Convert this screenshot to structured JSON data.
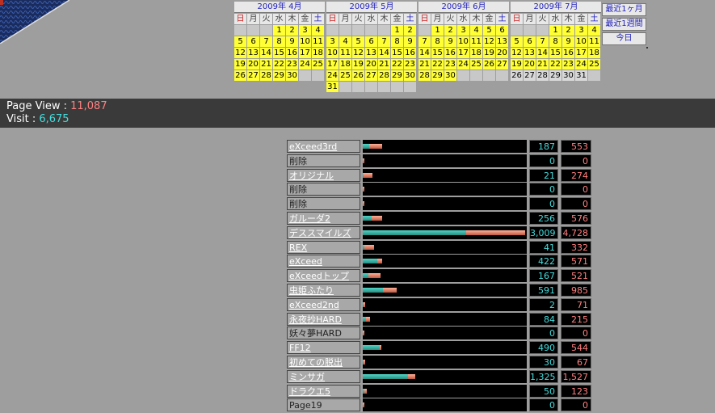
{
  "colors": {
    "background": "#9e9e9e",
    "highlight_day": "#ffff33",
    "page_view": "#ff8080",
    "visit": "#44dddd"
  },
  "weekdays": [
    "日",
    "月",
    "火",
    "水",
    "木",
    "金",
    "土"
  ],
  "calendars": [
    {
      "title": "2009年 4月",
      "days": [
        [
          "",
          "",
          "",
          "1",
          "2",
          "3",
          "4"
        ],
        [
          "5",
          "6",
          "7",
          "8",
          "9",
          "10",
          "11"
        ],
        [
          "12",
          "13",
          "14",
          "15",
          "16",
          "17",
          "18"
        ],
        [
          "19",
          "20",
          "21",
          "22",
          "23",
          "24",
          "25"
        ],
        [
          "26",
          "27",
          "28",
          "29",
          "30",
          "",
          ""
        ]
      ]
    },
    {
      "title": "2009年 5月",
      "days": [
        [
          "",
          "",
          "",
          "",
          "",
          "1",
          "2"
        ],
        [
          "3",
          "4",
          "5",
          "6",
          "7",
          "8",
          "9"
        ],
        [
          "10",
          "11",
          "12",
          "13",
          "14",
          "15",
          "16"
        ],
        [
          "17",
          "18",
          "19",
          "20",
          "21",
          "22",
          "23"
        ],
        [
          "24",
          "25",
          "26",
          "27",
          "28",
          "29",
          "30"
        ],
        [
          "31",
          "",
          "",
          "",
          "",
          "",
          ""
        ]
      ]
    },
    {
      "title": "2009年 6月",
      "days": [
        [
          "",
          "1",
          "2",
          "3",
          "4",
          "5",
          "6"
        ],
        [
          "7",
          "8",
          "9",
          "10",
          "11",
          "12",
          "13"
        ],
        [
          "14",
          "15",
          "16",
          "17",
          "18",
          "19",
          "20"
        ],
        [
          "21",
          "22",
          "23",
          "24",
          "25",
          "26",
          "27"
        ],
        [
          "28",
          "29",
          "30",
          "",
          "",
          "",
          ""
        ]
      ]
    },
    {
      "title": "2009年 7月",
      "days": [
        [
          "",
          "",
          "",
          "1",
          "2",
          "3",
          "4"
        ],
        [
          "5",
          "6",
          "7",
          "8",
          "9",
          "10",
          "11"
        ],
        [
          "12",
          "13",
          "14",
          "15",
          "16",
          "17",
          "18"
        ],
        [
          "19",
          "20",
          "21",
          "22",
          "23",
          "24",
          "25"
        ],
        [
          "26",
          "27",
          "28",
          "29",
          "30",
          "31",
          ""
        ]
      ]
    }
  ],
  "range_links": [
    "最近1ヶ月",
    "最近1週間",
    "今日"
  ],
  "stats": {
    "page_view_label": "Page View : ",
    "page_view": "11,087",
    "visit_label": "Visit : ",
    "visit": "6,675"
  },
  "ranking_max": 4728,
  "ranking": [
    {
      "name": "eXceed3rd",
      "link": true,
      "visit": "187",
      "pv": "553",
      "v": 187,
      "p": 553
    },
    {
      "name": "削除",
      "link": false,
      "visit": "0",
      "pv": "0",
      "v": 0,
      "p": 0
    },
    {
      "name": "オリジナル",
      "link": true,
      "visit": "21",
      "pv": "274",
      "v": 21,
      "p": 274
    },
    {
      "name": "削除",
      "link": false,
      "visit": "0",
      "pv": "0",
      "v": 0,
      "p": 0
    },
    {
      "name": "削除",
      "link": false,
      "visit": "0",
      "pv": "0",
      "v": 0,
      "p": 0
    },
    {
      "name": "ガルーダ2",
      "link": true,
      "visit": "256",
      "pv": "576",
      "v": 256,
      "p": 576
    },
    {
      "name": "デススマイルズ",
      "link": true,
      "visit": "3,009",
      "pv": "4,728",
      "v": 3009,
      "p": 4728
    },
    {
      "name": "REX",
      "link": true,
      "visit": "41",
      "pv": "332",
      "v": 41,
      "p": 332
    },
    {
      "name": "eXceed",
      "link": true,
      "visit": "422",
      "pv": "571",
      "v": 422,
      "p": 571
    },
    {
      "name": "eXceedトップ",
      "link": true,
      "visit": "167",
      "pv": "521",
      "v": 167,
      "p": 521
    },
    {
      "name": "虫姫ふたり",
      "link": true,
      "visit": "591",
      "pv": "985",
      "v": 591,
      "p": 985
    },
    {
      "name": "eXceed2nd",
      "link": true,
      "visit": "2",
      "pv": "71",
      "v": 2,
      "p": 71
    },
    {
      "name": "永夜抄HARD",
      "link": true,
      "visit": "84",
      "pv": "215",
      "v": 84,
      "p": 215
    },
    {
      "name": "妖々夢HARD",
      "link": false,
      "visit": "0",
      "pv": "0",
      "v": 0,
      "p": 0
    },
    {
      "name": "FF12",
      "link": true,
      "visit": "490",
      "pv": "544",
      "v": 490,
      "p": 544
    },
    {
      "name": "初めての脱出",
      "link": true,
      "visit": "30",
      "pv": "67",
      "v": 30,
      "p": 67
    },
    {
      "name": "ミンサガ",
      "link": true,
      "visit": "1,325",
      "pv": "1,527",
      "v": 1325,
      "p": 1527
    },
    {
      "name": "ドラクエ5",
      "link": true,
      "visit": "50",
      "pv": "123",
      "v": 50,
      "p": 123
    },
    {
      "name": "Page19",
      "link": false,
      "visit": "0",
      "pv": "0",
      "v": 0,
      "p": 0
    }
  ]
}
